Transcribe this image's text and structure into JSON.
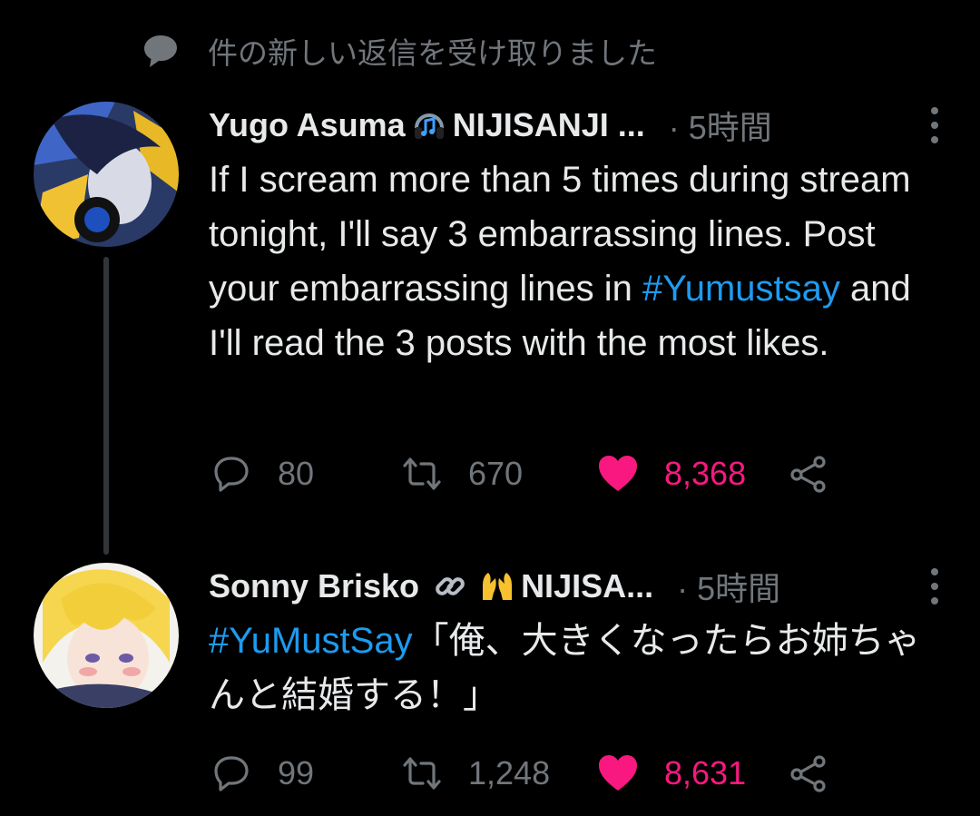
{
  "notice": {
    "text": "件の新しい返信を受け取りました"
  },
  "tweets": [
    {
      "name": "Yugo Asuma",
      "suffix": "NIJISANJI ...",
      "time": "5時間",
      "body_parts": [
        {
          "text": "If I scream more than 5 times during stream tonight, I'll say 3 embarrassing lines. Post your embarrassing lines in "
        },
        {
          "text": "#Yumustsay"
        },
        {
          "text": " and I'll read the 3 posts with the most likes."
        }
      ],
      "replies": "80",
      "retweets": "670",
      "likes": "8,368"
    },
    {
      "name": "Sonny Brisko",
      "suffix": "NIJISA...",
      "time": "5時間",
      "body_parts": [
        {
          "text": "#YuMustSay"
        },
        {
          "text": "「俺、大きくなったらお姉ちゃんと結婚する！」"
        }
      ],
      "replies": "99",
      "retweets": "1,248",
      "likes": "8,631"
    }
  ],
  "colors": {
    "accent": "#1d9bf0",
    "like": "#f91880",
    "muted": "#71767b"
  },
  "icons": [
    "comment-icon",
    "headphones-icon",
    "link-icon",
    "raising-hands-icon",
    "reply-icon",
    "retweet-icon",
    "heart-icon",
    "share-icon",
    "more-icon"
  ]
}
